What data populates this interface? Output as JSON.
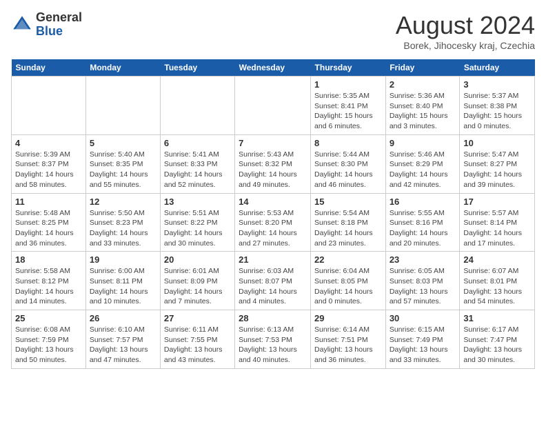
{
  "logo": {
    "general": "General",
    "blue": "Blue"
  },
  "title": "August 2024",
  "location": "Borek, Jihocesky kraj, Czechia",
  "headers": [
    "Sunday",
    "Monday",
    "Tuesday",
    "Wednesday",
    "Thursday",
    "Friday",
    "Saturday"
  ],
  "weeks": [
    [
      {
        "day": "",
        "info": ""
      },
      {
        "day": "",
        "info": ""
      },
      {
        "day": "",
        "info": ""
      },
      {
        "day": "",
        "info": ""
      },
      {
        "day": "1",
        "info": "Sunrise: 5:35 AM\nSunset: 8:41 PM\nDaylight: 15 hours\nand 6 minutes."
      },
      {
        "day": "2",
        "info": "Sunrise: 5:36 AM\nSunset: 8:40 PM\nDaylight: 15 hours\nand 3 minutes."
      },
      {
        "day": "3",
        "info": "Sunrise: 5:37 AM\nSunset: 8:38 PM\nDaylight: 15 hours\nand 0 minutes."
      }
    ],
    [
      {
        "day": "4",
        "info": "Sunrise: 5:39 AM\nSunset: 8:37 PM\nDaylight: 14 hours\nand 58 minutes."
      },
      {
        "day": "5",
        "info": "Sunrise: 5:40 AM\nSunset: 8:35 PM\nDaylight: 14 hours\nand 55 minutes."
      },
      {
        "day": "6",
        "info": "Sunrise: 5:41 AM\nSunset: 8:33 PM\nDaylight: 14 hours\nand 52 minutes."
      },
      {
        "day": "7",
        "info": "Sunrise: 5:43 AM\nSunset: 8:32 PM\nDaylight: 14 hours\nand 49 minutes."
      },
      {
        "day": "8",
        "info": "Sunrise: 5:44 AM\nSunset: 8:30 PM\nDaylight: 14 hours\nand 46 minutes."
      },
      {
        "day": "9",
        "info": "Sunrise: 5:46 AM\nSunset: 8:29 PM\nDaylight: 14 hours\nand 42 minutes."
      },
      {
        "day": "10",
        "info": "Sunrise: 5:47 AM\nSunset: 8:27 PM\nDaylight: 14 hours\nand 39 minutes."
      }
    ],
    [
      {
        "day": "11",
        "info": "Sunrise: 5:48 AM\nSunset: 8:25 PM\nDaylight: 14 hours\nand 36 minutes."
      },
      {
        "day": "12",
        "info": "Sunrise: 5:50 AM\nSunset: 8:23 PM\nDaylight: 14 hours\nand 33 minutes."
      },
      {
        "day": "13",
        "info": "Sunrise: 5:51 AM\nSunset: 8:22 PM\nDaylight: 14 hours\nand 30 minutes."
      },
      {
        "day": "14",
        "info": "Sunrise: 5:53 AM\nSunset: 8:20 PM\nDaylight: 14 hours\nand 27 minutes."
      },
      {
        "day": "15",
        "info": "Sunrise: 5:54 AM\nSunset: 8:18 PM\nDaylight: 14 hours\nand 23 minutes."
      },
      {
        "day": "16",
        "info": "Sunrise: 5:55 AM\nSunset: 8:16 PM\nDaylight: 14 hours\nand 20 minutes."
      },
      {
        "day": "17",
        "info": "Sunrise: 5:57 AM\nSunset: 8:14 PM\nDaylight: 14 hours\nand 17 minutes."
      }
    ],
    [
      {
        "day": "18",
        "info": "Sunrise: 5:58 AM\nSunset: 8:12 PM\nDaylight: 14 hours\nand 14 minutes."
      },
      {
        "day": "19",
        "info": "Sunrise: 6:00 AM\nSunset: 8:11 PM\nDaylight: 14 hours\nand 10 minutes."
      },
      {
        "day": "20",
        "info": "Sunrise: 6:01 AM\nSunset: 8:09 PM\nDaylight: 14 hours\nand 7 minutes."
      },
      {
        "day": "21",
        "info": "Sunrise: 6:03 AM\nSunset: 8:07 PM\nDaylight: 14 hours\nand 4 minutes."
      },
      {
        "day": "22",
        "info": "Sunrise: 6:04 AM\nSunset: 8:05 PM\nDaylight: 14 hours\nand 0 minutes."
      },
      {
        "day": "23",
        "info": "Sunrise: 6:05 AM\nSunset: 8:03 PM\nDaylight: 13 hours\nand 57 minutes."
      },
      {
        "day": "24",
        "info": "Sunrise: 6:07 AM\nSunset: 8:01 PM\nDaylight: 13 hours\nand 54 minutes."
      }
    ],
    [
      {
        "day": "25",
        "info": "Sunrise: 6:08 AM\nSunset: 7:59 PM\nDaylight: 13 hours\nand 50 minutes."
      },
      {
        "day": "26",
        "info": "Sunrise: 6:10 AM\nSunset: 7:57 PM\nDaylight: 13 hours\nand 47 minutes."
      },
      {
        "day": "27",
        "info": "Sunrise: 6:11 AM\nSunset: 7:55 PM\nDaylight: 13 hours\nand 43 minutes."
      },
      {
        "day": "28",
        "info": "Sunrise: 6:13 AM\nSunset: 7:53 PM\nDaylight: 13 hours\nand 40 minutes."
      },
      {
        "day": "29",
        "info": "Sunrise: 6:14 AM\nSunset: 7:51 PM\nDaylight: 13 hours\nand 36 minutes."
      },
      {
        "day": "30",
        "info": "Sunrise: 6:15 AM\nSunset: 7:49 PM\nDaylight: 13 hours\nand 33 minutes."
      },
      {
        "day": "31",
        "info": "Sunrise: 6:17 AM\nSunset: 7:47 PM\nDaylight: 13 hours\nand 30 minutes."
      }
    ]
  ]
}
